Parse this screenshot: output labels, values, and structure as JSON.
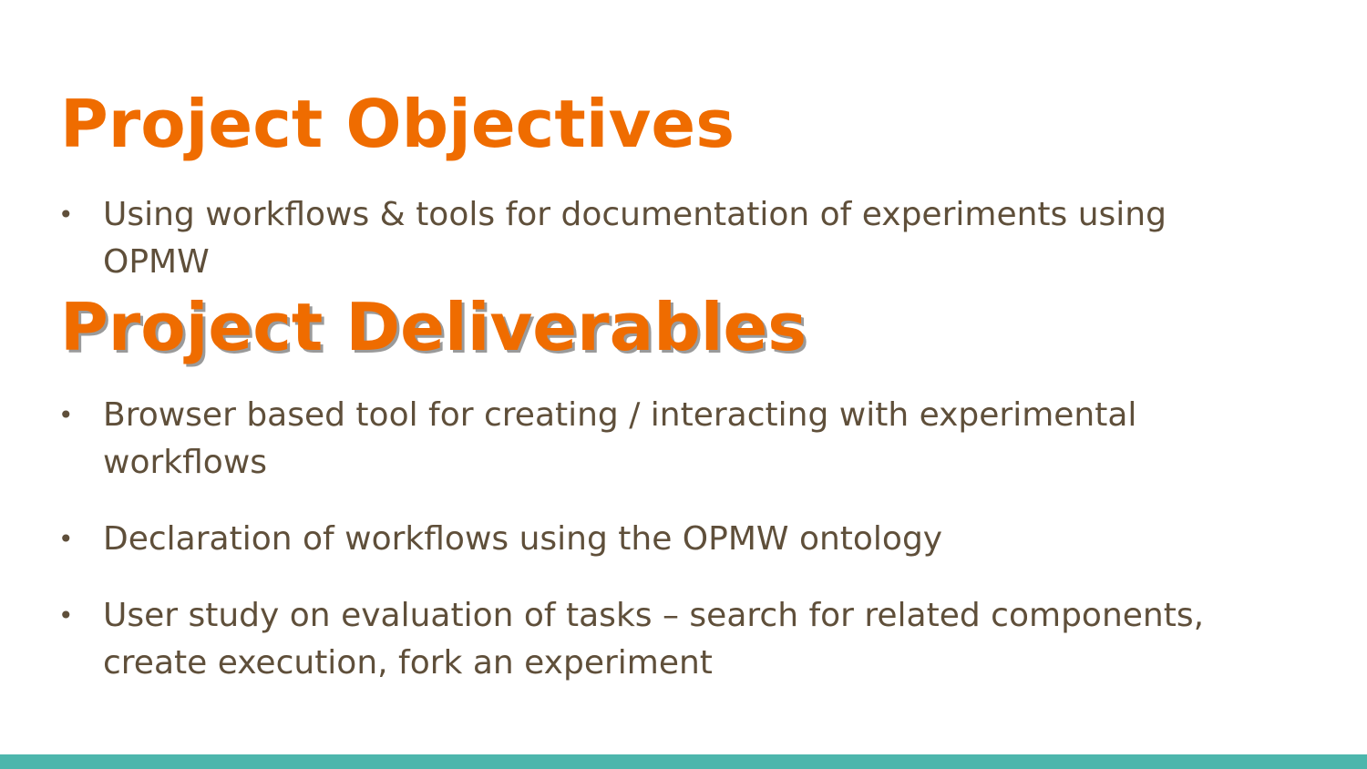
{
  "slide": {
    "objectives": {
      "title": "Project Objectives",
      "items": [
        "Using workflows & tools for documentation of experiments using OPMW"
      ]
    },
    "deliverables": {
      "title": "Project Deliverables",
      "items": [
        "Browser based tool for creating / interacting with experimental workflows",
        "Declaration of workflows using the OPMW ontology",
        "User study on evaluation of tasks – search for related components, create execution, fork an experiment"
      ]
    },
    "bullet_glyph": "•",
    "colors": {
      "heading": "#ef6c00",
      "body_text": "#5f4f3a",
      "bottom_bar": "#4db6ac",
      "heading_shadow": "#9a9a9a"
    }
  }
}
